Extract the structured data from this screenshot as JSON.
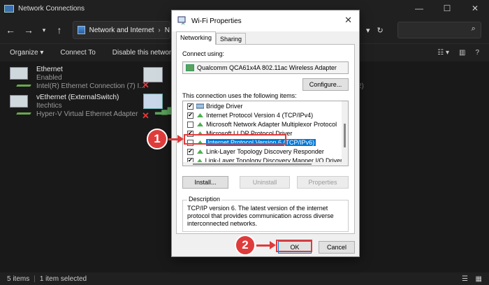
{
  "explorer": {
    "title": "Network Connections",
    "breadcrumb": [
      "Network and Internet",
      "N"
    ],
    "commands": [
      "Organize ▾",
      "Connect To",
      "Disable this network devi"
    ],
    "connections": [
      {
        "name": "Ethernet",
        "status": "Enabled",
        "adapter": "Intel(R) Ethernet Connection (7) I..."
      },
      {
        "name": "vEthernet (ExternalSwitch)",
        "status": "Itechtics",
        "adapter": "Hyper-V Virtual Ethernet Adapter"
      }
    ],
    "partial_text": "2)",
    "status_items": "5 items",
    "status_selected": "1 item selected"
  },
  "dialog": {
    "title": "Wi-Fi Properties",
    "tabs": [
      "Networking",
      "Sharing"
    ],
    "connect_using_label": "Connect using:",
    "adapter": "Qualcomm QCA61x4A 802.11ac Wireless Adapter",
    "configure_button": "Configure...",
    "items_label": "This connection uses the following items:",
    "items": [
      {
        "label": "Bridge Driver",
        "checked": true,
        "icon": "bridge-icon"
      },
      {
        "label": "Internet Protocol Version 4 (TCP/IPv4)",
        "checked": true,
        "icon": "protocol-icon"
      },
      {
        "label": "Microsoft Network Adapter Multiplexor Protocol",
        "checked": false,
        "icon": "protocol-icon"
      },
      {
        "label": "Microsoft LLDP Protocol Driver",
        "checked": true,
        "icon": "protocol-icon"
      },
      {
        "label": "Internet Protocol Version 6 (TCP/IPv6)",
        "checked": false,
        "icon": "protocol-icon",
        "selected": true
      },
      {
        "label": "Link-Layer Topology Discovery Responder",
        "checked": true,
        "icon": "protocol-icon"
      },
      {
        "label": "Link-Layer Topology Discovery Mapper I/O Driver",
        "checked": true,
        "icon": "protocol-icon"
      }
    ],
    "install_button": "Install...",
    "uninstall_button": "Uninstall",
    "properties_button": "Properties",
    "description_label": "Description",
    "description": "TCP/IP version 6. The latest version of the internet protocol that provides communication across diverse interconnected networks.",
    "ok_button": "OK",
    "cancel_button": "Cancel"
  },
  "callouts": [
    "1",
    "2"
  ],
  "colors": {
    "accent": "#0078d7",
    "callout": "#e03b3b"
  }
}
